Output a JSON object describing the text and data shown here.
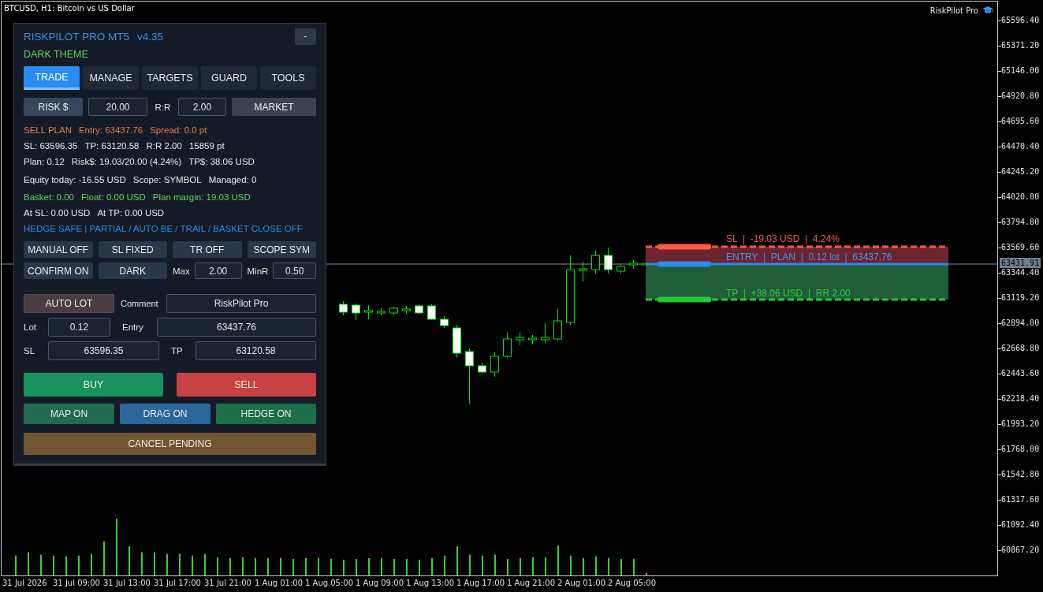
{
  "chart": {
    "title": "BTCUSD, H1:  Bitcoin vs US Dollar",
    "indicator_label": "RiskPilot Pro",
    "price_axis": [
      "65596.40",
      "65371.20",
      "65146.00",
      "64920.80",
      "64695.60",
      "64470.40",
      "64245.20",
      "64020.00",
      "63794.80",
      "63569.60",
      "63344.40",
      "63119.20",
      "62894.00",
      "62668.80",
      "62443.60",
      "62218.40",
      "61993.20",
      "61768.00",
      "61542.80",
      "61317.60",
      "61092.40",
      "60867.20"
    ],
    "current_price": "63431.91",
    "time_axis": [
      "31 Jul 2026",
      "31 Jul 09:00",
      "31 Jul 13:00",
      "31 Jul 17:00",
      "31 Jul 21:00",
      "1 Aug 01:00",
      "1 Aug 05:00",
      "1 Aug 09:00",
      "1 Aug 13:00",
      "1 Aug 17:00",
      "1 Aug 21:00",
      "2 Aug 01:00",
      "2 Aug 05:00"
    ],
    "levels": [
      {
        "kind": "sl",
        "label": "SL  |  -19.03 USD  |  4.24%"
      },
      {
        "kind": "entry",
        "label": "ENTRY  |  PLAN  |  0.12 lot  |  63437.76"
      },
      {
        "kind": "tp",
        "label": "TP  |  +38.06 USD  |  RR 2.00"
      }
    ]
  },
  "panel": {
    "title": "RISKPILOT PRO MT5",
    "version": "v4.35",
    "minimize": "-",
    "theme": "DARK THEME",
    "tabs": [
      {
        "label": "TRADE",
        "selected": true
      },
      {
        "label": "MANAGE",
        "selected": false
      },
      {
        "label": "TARGETS",
        "selected": false
      },
      {
        "label": "GUARD",
        "selected": false
      },
      {
        "label": "TOOLS",
        "selected": false
      }
    ],
    "risk_row": {
      "mode": "RISK $",
      "risk": "20.00",
      "rr_label": "R:R",
      "rr": "2.00",
      "order_type": "MARKET"
    },
    "info_lines": [
      {
        "kind": "plan",
        "items": [
          "SELL PLAN",
          "Entry: 63437.76",
          "Spread: 0.0 pt"
        ]
      },
      {
        "kind": "normal",
        "items": [
          "SL: 63596.35",
          "TP: 63120.58",
          "R:R 2.00",
          "15859 pt"
        ]
      },
      {
        "kind": "normal",
        "items": [
          "Plan: 0.12",
          "Risk$: 19.03/20.00 (4.24%)",
          "TP$: 38.06 USD"
        ]
      },
      {
        "kind": "normal",
        "items": [
          "Equity today: -16.55 USD",
          "Scope: SYMBOL",
          "Managed: 0"
        ]
      },
      {
        "kind": "good",
        "items": [
          "Basket: 0.00",
          "Float: 0.00 USD",
          "Plan margin: 19.03 USD"
        ]
      },
      {
        "kind": "normal",
        "items": [
          "At SL: 0.00 USD",
          "At TP: 0.00 USD"
        ]
      },
      {
        "kind": "flags",
        "items": [
          "HEDGE SAFE | PARTIAL / AUTO BE / TRAIL / BASKET CLOSE OFF"
        ]
      }
    ],
    "settings_rows": [
      [
        {
          "kind": "button",
          "label": "MANUAL OFF"
        },
        {
          "kind": "button",
          "label": "SL FIXED"
        },
        {
          "kind": "button",
          "label": "TR OFF"
        },
        {
          "kind": "button",
          "label": "SCOPE SYM"
        }
      ],
      [
        {
          "kind": "button",
          "label": "CONFIRM ON"
        },
        {
          "kind": "button",
          "label": "DARK"
        },
        {
          "kind": "field",
          "label": "Max",
          "value": "2.00"
        },
        {
          "kind": "field",
          "label": "MinR",
          "value": "0.50"
        }
      ]
    ],
    "order_rows": [
      [
        {
          "kind": "button",
          "label": "AUTO LOT"
        },
        {
          "kind": "field",
          "label": "Comment",
          "value": "RiskPilot Pro"
        }
      ],
      [
        {
          "kind": "field",
          "label": "Lot",
          "value": "0.12"
        },
        {
          "kind": "field",
          "label": "Entry",
          "value": "63437.76"
        }
      ],
      [
        {
          "kind": "field",
          "label": "SL",
          "value": "63596.35"
        },
        {
          "kind": "field",
          "label": "TP",
          "value": "63120.58"
        }
      ]
    ],
    "actions": [
      {
        "kind": "buy",
        "label": "BUY"
      },
      {
        "kind": "sell",
        "label": "SELL"
      }
    ],
    "switches": [
      {
        "kind": "map",
        "label": "MAP ON"
      },
      {
        "kind": "drag",
        "label": "DRAG ON"
      },
      {
        "kind": "hedge",
        "label": "HEDGE ON"
      }
    ],
    "cancel": "CANCEL PENDING"
  }
}
